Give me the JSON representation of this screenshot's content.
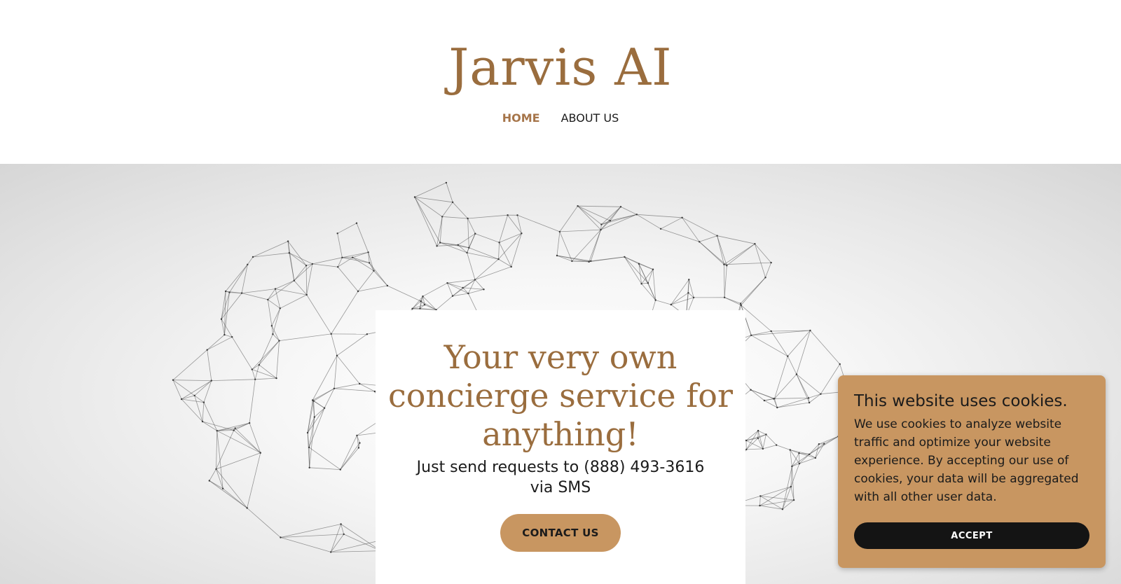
{
  "brand": {
    "name": "Jarvis AI",
    "color": "#9a6d3e"
  },
  "nav": {
    "items": [
      {
        "label": "HOME",
        "active": true
      },
      {
        "label": "ABOUT US",
        "active": false
      }
    ]
  },
  "hero": {
    "background_image": "wireframe-brain-network",
    "title": "Your very own concierge service for anything!",
    "subtitle": "Just send requests to (888) 493-3616 via SMS",
    "cta_label": "CONTACT US",
    "cta_color": "#c89661"
  },
  "cookie_banner": {
    "title": "This website uses cookies.",
    "text": "We use cookies to analyze website traffic and optimize your website experience. By accepting our use of cookies, your data will be aggregated with all other user data.",
    "accept_label": "ACCEPT",
    "background_color": "#c89661"
  }
}
